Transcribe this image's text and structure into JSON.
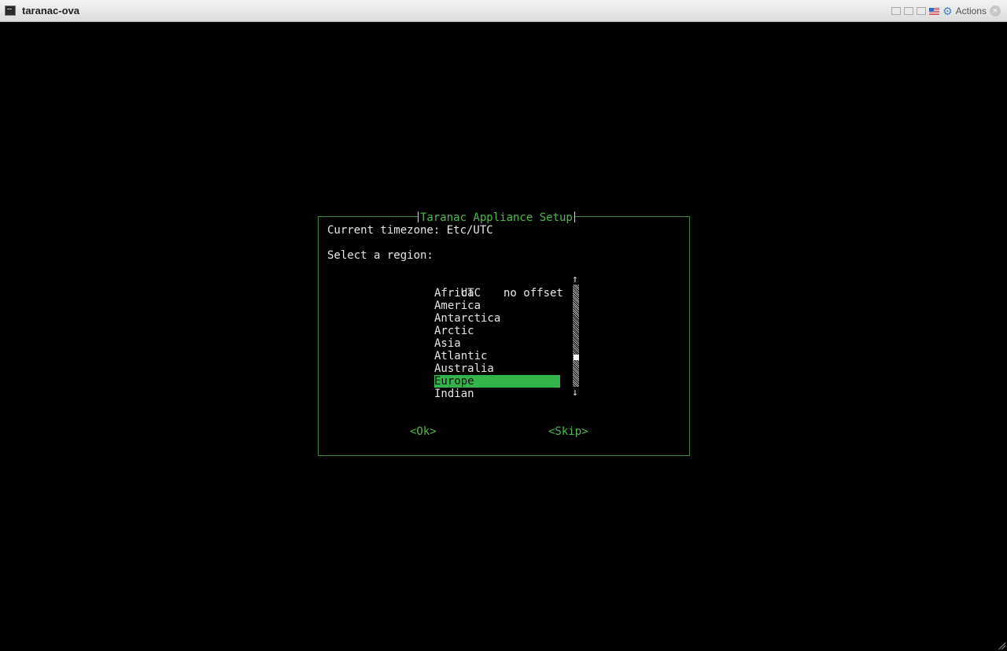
{
  "window": {
    "title": "taranac-ova",
    "actions_label": "Actions"
  },
  "dialog": {
    "title": "Taranac Appliance Setup",
    "current_timezone": "Current timezone: Etc/UTC",
    "prompt": "Select a region:",
    "regions": [
      {
        "name": "UTC",
        "offset": "no offset"
      },
      {
        "name": "Africa"
      },
      {
        "name": "America"
      },
      {
        "name": "Antarctica"
      },
      {
        "name": "Arctic"
      },
      {
        "name": "Asia"
      },
      {
        "name": "Atlantic"
      },
      {
        "name": "Australia"
      },
      {
        "name": "Europe",
        "selected": true
      },
      {
        "name": "Indian"
      }
    ],
    "ok_label": "<Ok>",
    "skip_label": "<Skip>",
    "scroll_up_glyph": "↑",
    "scroll_down_glyph": "↓"
  },
  "colors": {
    "accent": "#33b44a",
    "border": "#3a8c3a",
    "text": "#e6e6e6"
  }
}
